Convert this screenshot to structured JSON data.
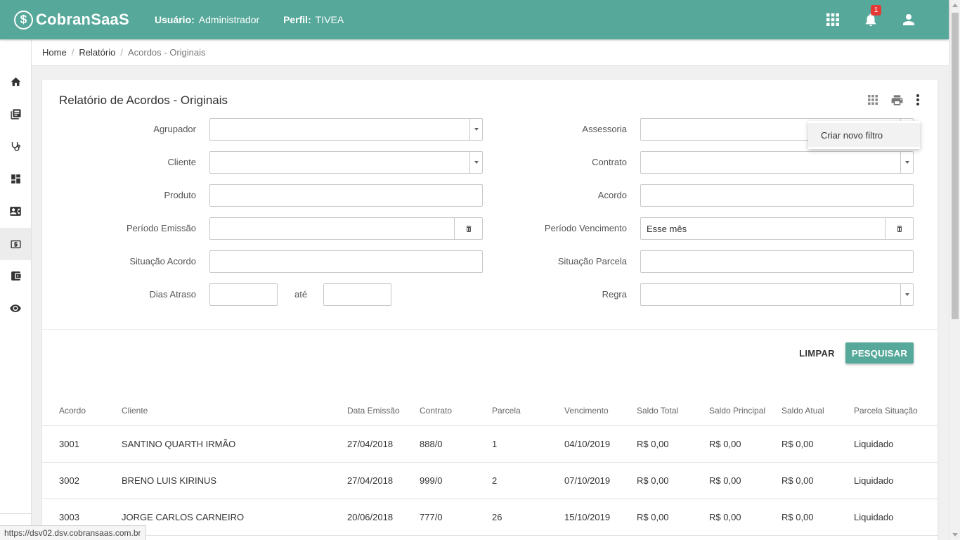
{
  "header": {
    "logo_text": "CobranSaaS",
    "user_label": "Usuário:",
    "user_value": "Administrador",
    "profile_label": "Perfil:",
    "profile_value": "TIVEA",
    "notification_count": "1",
    "icons": [
      "apps-grid-icon",
      "bell-icon",
      "account-icon"
    ]
  },
  "sidebar": {
    "items": [
      {
        "icon": "home-icon"
      },
      {
        "icon": "library-books-icon"
      },
      {
        "icon": "stethoscope-icon"
      },
      {
        "icon": "dashboard-icon"
      },
      {
        "icon": "contact-card-icon"
      },
      {
        "icon": "money-icon",
        "active": true
      },
      {
        "icon": "wallet-icon"
      },
      {
        "icon": "eye-icon"
      }
    ]
  },
  "breadcrumb": {
    "items": [
      "Home",
      "Relatório",
      "Acordos - Originais"
    ]
  },
  "page": {
    "title": "Relatório de Acordos - Originais",
    "tools": [
      "grid-view-icon",
      "print-icon",
      "more-vert-icon"
    ]
  },
  "menu": {
    "items": [
      "Criar novo filtro"
    ]
  },
  "filters": {
    "agrupador": {
      "label": "Agrupador",
      "value": ""
    },
    "cliente": {
      "label": "Cliente",
      "value": ""
    },
    "produto": {
      "label": "Produto",
      "value": ""
    },
    "periodo_emissao": {
      "label": "Período Emissão",
      "value": ""
    },
    "situacao_acordo": {
      "label": "Situação Acordo",
      "value": ""
    },
    "dias_atraso": {
      "label": "Dias Atraso",
      "from": "",
      "to_label": "até",
      "to": ""
    },
    "assessoria": {
      "label": "Assessoria",
      "value": ""
    },
    "contrato": {
      "label": "Contrato",
      "value": ""
    },
    "acordo": {
      "label": "Acordo",
      "value": ""
    },
    "periodo_vencimento": {
      "label": "Período Vencimento",
      "value": "Esse mês"
    },
    "situacao_parcela": {
      "label": "Situação Parcela",
      "value": ""
    },
    "regra": {
      "label": "Regra",
      "value": ""
    }
  },
  "actions": {
    "clear_label": "LIMPAR",
    "search_label": "PESQUISAR"
  },
  "table": {
    "columns": [
      "Acordo",
      "Cliente",
      "Data Emissão",
      "Contrato",
      "Parcela",
      "Vencimento",
      "Saldo Total",
      "Saldo Principal",
      "Saldo Atual",
      "Parcela Situação"
    ],
    "rows": [
      [
        "3001",
        "SANTINO QUARTH IRMÃO",
        "27/04/2018",
        "888/0",
        "1",
        "04/10/2019",
        "R$ 0,00",
        "R$ 0,00",
        "R$ 0,00",
        "Liquidado"
      ],
      [
        "3002",
        "BRENO LUIS KIRINUS",
        "27/04/2018",
        "999/0",
        "2",
        "07/10/2019",
        "R$ 0,00",
        "R$ 0,00",
        "R$ 0,00",
        "Liquidado"
      ],
      [
        "3003",
        "JORGE CARLOS CARNEIRO",
        "20/06/2018",
        "777/0",
        "26",
        "15/10/2019",
        "R$ 0,00",
        "R$ 0,00",
        "R$ 0,00",
        "Liquidado"
      ]
    ]
  },
  "status_url": "https://dsv02.dsv.cobransaas.com.br",
  "colors": {
    "brand": "#56a89a",
    "badge": "#e53935"
  }
}
